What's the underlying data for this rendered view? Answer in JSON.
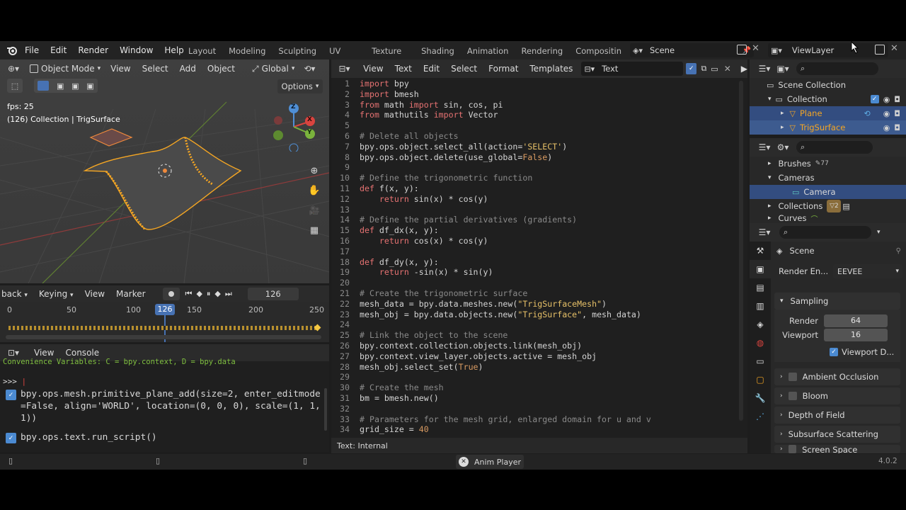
{
  "topbar": {
    "menus": [
      "File",
      "Edit",
      "Render",
      "Window",
      "Help"
    ],
    "workspaces": [
      "Layout",
      "Modeling",
      "Sculpting",
      "UV Editing",
      "Texture Paint",
      "Shading",
      "Animation",
      "Rendering",
      "Compositin"
    ],
    "scene": "Scene",
    "view_layer": "ViewLayer"
  },
  "viewport": {
    "mode": "Object Mode",
    "menus": [
      "View",
      "Select",
      "Add",
      "Object"
    ],
    "transform": "Global",
    "options": "Options",
    "fps": "fps: 25",
    "info": "(126) Collection | TrigSurface",
    "gizmo": {
      "x": "X",
      "y": "Y",
      "z": "Z"
    }
  },
  "timeline": {
    "menus": [
      "back",
      "Keying",
      "View",
      "Marker"
    ],
    "frame": "126",
    "ticks": [
      "0",
      "50",
      "100",
      "150",
      "200",
      "250"
    ],
    "current": "126"
  },
  "console": {
    "menus": [
      "View",
      "Console"
    ],
    "banner": "Convenience Variables: C = bpy.context, D = bpy.data",
    "prompt": ">>>",
    "entries": [
      "bpy.ops.mesh.primitive_plane_add(size=2, enter_editmode=False, align='WORLD', location=(0, 0, 0), scale=(1, 1, 1))",
      "bpy.ops.text.run_script()"
    ]
  },
  "text_editor": {
    "menus": [
      "View",
      "Text",
      "Edit",
      "Select",
      "Format",
      "Templates"
    ],
    "name": "Text",
    "footer": "Text: Internal",
    "lines": [
      "import bpy",
      "import bmesh",
      "from math import sin, cos, pi",
      "from mathutils import Vector",
      "",
      "# Delete all objects",
      "bpy.ops.object.select_all(action='SELECT')",
      "bpy.ops.object.delete(use_global=False)",
      "",
      "# Define the trigonometric function",
      "def f(x, y):",
      "    return sin(x) * cos(y)",
      "",
      "# Define the partial derivatives (gradients)",
      "def df_dx(x, y):",
      "    return cos(x) * cos(y)",
      "",
      "def df_dy(x, y):",
      "    return -sin(x) * sin(y)",
      "",
      "# Create the trigonometric surface",
      "mesh_data = bpy.data.meshes.new(\"TrigSurfaceMesh\")",
      "mesh_obj = bpy.data.objects.new(\"TrigSurface\", mesh_data)",
      "",
      "# Link the object to the scene",
      "bpy.context.collection.objects.link(mesh_obj)",
      "bpy.context.view_layer.objects.active = mesh_obj",
      "mesh_obj.select_set(True)",
      "",
      "# Create the mesh",
      "bm = bmesh.new()",
      "",
      "# Parameters for the mesh grid, enlarged domain for u and v",
      "grid_size = 40"
    ]
  },
  "outliner": {
    "root": "Scene Collection",
    "collection": "Collection",
    "items": [
      "Plane",
      "TrigSurface"
    ]
  },
  "blend_browser": {
    "items": [
      "Brushes",
      "Cameras",
      "Camera",
      "Collections",
      "Curves"
    ],
    "brush_count": "77",
    "coll_count": "2"
  },
  "properties": {
    "scene": "Scene",
    "render_engine_label": "Render En...",
    "render_engine": "EEVEE",
    "sampling": "Sampling",
    "render_label": "Render",
    "render_value": "64",
    "viewport_label": "Viewport",
    "viewport_value": "16",
    "viewport_denoise": "Viewport D...",
    "sections": [
      "Ambient Occlusion",
      "Bloom",
      "Depth of Field",
      "Subsurface Scattering",
      "Screen Space Reflections"
    ]
  },
  "statusbar": {
    "center": "Anim Player",
    "version": "4.0.2"
  },
  "colors": {
    "accent": "#4772b3",
    "selected": "#334d80",
    "orange": "#f5a623"
  }
}
